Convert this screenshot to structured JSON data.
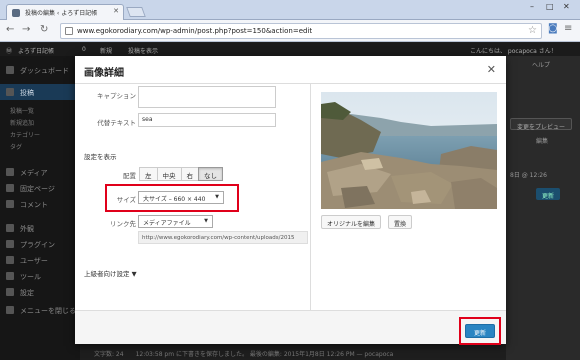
{
  "browser": {
    "tab_title": "投稿の編集 ‹ よろず日記帳",
    "address": "www.egokorodiary.com/wp-admin/post.php?post=150&action=edit"
  },
  "adminbar": {
    "site_name": "よろず日記帳",
    "comments": "0",
    "new_label": "新規",
    "view_label": "投稿を表示",
    "greeting": "こんにちは、 pocapoca さん！"
  },
  "sidebar": {
    "items": [
      {
        "label": "ダッシュボード"
      },
      {
        "label": "投稿"
      },
      {
        "label": "メディア"
      },
      {
        "label": "固定ページ"
      },
      {
        "label": "コメント"
      },
      {
        "label": "外観"
      },
      {
        "label": "プラグイン"
      },
      {
        "label": "ユーザー"
      },
      {
        "label": "ツール"
      },
      {
        "label": "設定"
      },
      {
        "label": "メニューを閉じる"
      }
    ],
    "subitems": [
      "投稿一覧",
      "新規追加",
      "カテゴリー",
      "タグ"
    ]
  },
  "background": {
    "help": "ヘルプ",
    "preview_btn": "変更をプレビュー",
    "edit_link": "編集",
    "date_text": "8日 @ 12:26",
    "update_btn": "更新",
    "footer_text": "文字数: 24　　12:03:58 pm に下書きを保存しました。 最後の編集: 2015年1月8日 12:26 PM — pocapoca"
  },
  "modal": {
    "title": "画像詳細",
    "caption_label": "キャプション",
    "caption_value": "",
    "alt_label": "代替テキスト",
    "alt_value": "sea",
    "display_settings": "設定を表示",
    "align_label": "配置",
    "align_options": [
      "左",
      "中央",
      "右",
      "なし"
    ],
    "align_selected": "なし",
    "size_label": "サイズ",
    "size_value": "大サイズ – 660 × 440",
    "link_label": "リンク先",
    "link_value": "メディアファイル",
    "link_url": "http://www.egokorodiary.com/wp-content/uploads/2015",
    "advanced": "上級者向け設定 ▼",
    "edit_original": "オリジナルを編集",
    "replace": "置換",
    "update": "更新"
  },
  "colors": {
    "highlight": "#e0001a",
    "primary_button": "#2a85c2"
  }
}
